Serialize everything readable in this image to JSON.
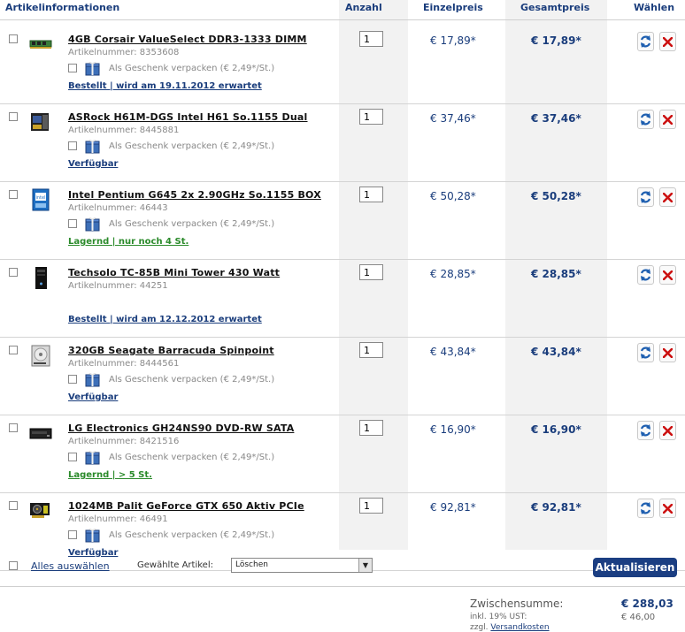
{
  "header": {
    "col_info": "Artikelinformationen",
    "col_qty": "Anzahl",
    "col_unit": "Einzelpreis",
    "col_total": "Gesamtpreis",
    "col_choose": "Wählen"
  },
  "items": [
    {
      "title": "4GB Corsair ValueSelect DDR3-1333 DIMM",
      "artnr": "Artikelnummer: 8353608",
      "gift": "Als Geschenk verpacken (€ 2,49*/St.)",
      "status": "Bestellt | wird am 19.11.2012 erwartet",
      "status_color": "#1a3d7c",
      "qty": "1",
      "unit_price": "€ 17,89*",
      "total_price": "€ 17,89*",
      "icon": "ram-module-icon"
    },
    {
      "title": "ASRock H61M-DGS Intel H61 So.1155 Dual",
      "artnr": "Artikelnummer: 8445881",
      "gift": "Als Geschenk verpacken (€ 2,49*/St.)",
      "status": "Verfügbar",
      "status_color": "#1a3d7c",
      "qty": "1",
      "unit_price": "€ 37,46*",
      "total_price": "€ 37,46*",
      "icon": "motherboard-box-icon"
    },
    {
      "title": "Intel Pentium G645 2x 2.90GHz So.1155 BOX",
      "artnr": "Artikelnummer: 46443",
      "gift": "Als Geschenk verpacken (€ 2,49*/St.)",
      "status": "Lagernd | nur noch 4 St.",
      "status_color": "#2a8a2a",
      "qty": "1",
      "unit_price": "€ 50,28*",
      "total_price": "€ 50,28*",
      "icon": "cpu-box-icon"
    },
    {
      "title": "Techsolo TC-85B Mini Tower 430 Watt",
      "artnr": "Artikelnummer: 44251",
      "gift": "",
      "status": "Bestellt | wird am 12.12.2012 erwartet",
      "status_color": "#1a3d7c",
      "qty": "1",
      "unit_price": "€ 28,85*",
      "total_price": "€ 28,85*",
      "icon": "tower-case-icon"
    },
    {
      "title": "320GB Seagate Barracuda Spinpoint",
      "artnr": "Artikelnummer: 8444561",
      "gift": "Als Geschenk verpacken (€ 2,49*/St.)",
      "status": "Verfügbar",
      "status_color": "#1a3d7c",
      "qty": "1",
      "unit_price": "€ 43,84*",
      "total_price": "€ 43,84*",
      "icon": "hard-drive-icon"
    },
    {
      "title": "LG Electronics GH24NS90 DVD-RW SATA",
      "artnr": "Artikelnummer: 8421516",
      "gift": "Als Geschenk verpacken (€ 2,49*/St.)",
      "status": "Lagernd | > 5 St.",
      "status_color": "#2a8a2a",
      "qty": "1",
      "unit_price": "€ 16,90*",
      "total_price": "€ 16,90*",
      "icon": "dvd-drive-icon"
    },
    {
      "title": "1024MB Palit GeForce GTX 650 Aktiv PCIe",
      "artnr": "Artikelnummer: 46491",
      "gift": "Als Geschenk verpacken (€ 2,49*/St.)",
      "status": "Verfügbar",
      "status_color": "#1a3d7c",
      "qty": "1",
      "unit_price": "€ 92,81*",
      "total_price": "€ 92,81*",
      "icon": "graphics-card-icon"
    }
  ],
  "footer": {
    "select_all": "Alles auswählen",
    "selected_label": "Gewählte Artikel:",
    "action_value": "Löschen",
    "update_button": "Aktualisieren"
  },
  "summary": {
    "subtotal_label": "Zwischensumme:",
    "subtotal_value": "€ 288,03",
    "tax_label": "inkl. 19% UST:",
    "tax_value": "€ 46,00",
    "shipping_prefix": "zzgl.",
    "shipping_link": "Versandkosten"
  },
  "colors": {
    "accent": "#1b3e82",
    "available": "#2a8a2a",
    "delete": "#cc1111"
  }
}
